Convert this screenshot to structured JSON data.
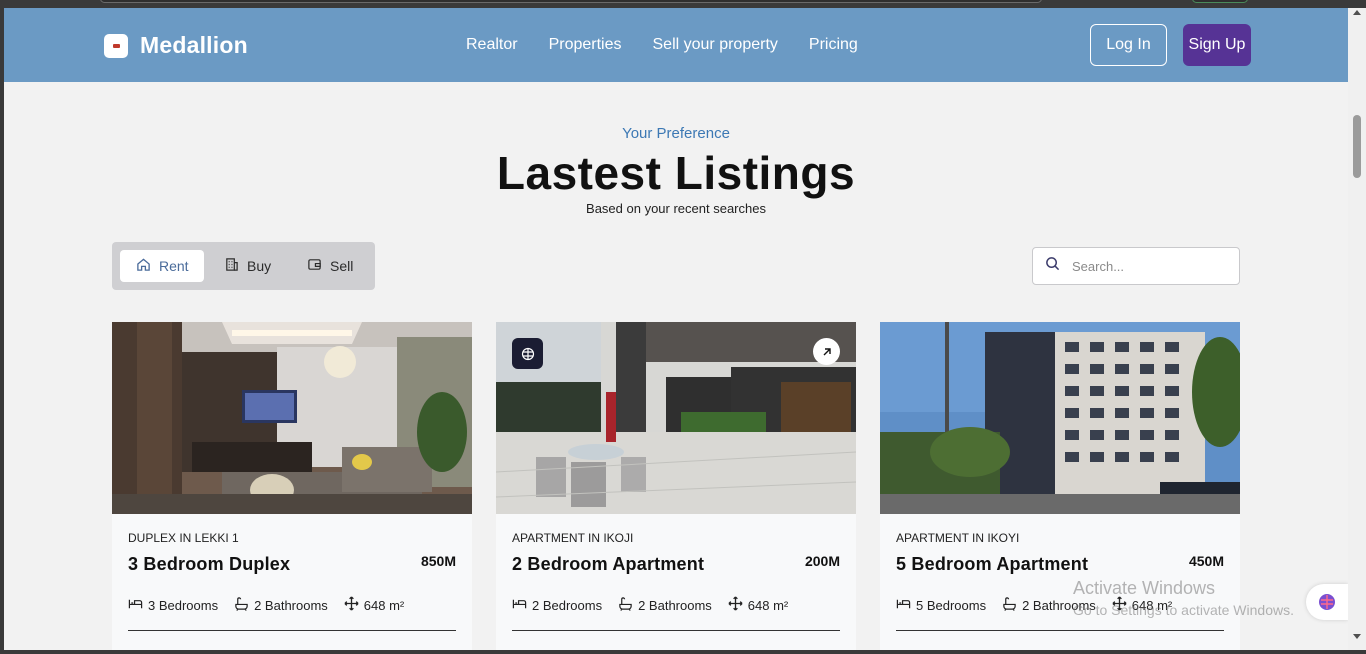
{
  "brand": {
    "name": "Medallion"
  },
  "nav": {
    "links": [
      "Realtor",
      "Properties",
      "Sell your property",
      "Pricing"
    ],
    "login": "Log In",
    "signup": "Sign Up"
  },
  "section": {
    "kicker": "Your Preference",
    "title": "Lastest Listings",
    "subtitle": "Based on your recent searches"
  },
  "tabs": [
    {
      "label": "Rent",
      "icon": "home-icon",
      "active": true
    },
    {
      "label": "Buy",
      "icon": "building-icon",
      "active": false
    },
    {
      "label": "Sell",
      "icon": "wallet-icon",
      "active": false
    }
  ],
  "search": {
    "placeholder": "Search..."
  },
  "listings": [
    {
      "type": "DUPLEX IN LEKKI 1",
      "title": "3 Bedroom Duplex",
      "price": "850M",
      "bedrooms": "3 Bedrooms",
      "bathrooms": "2 Bathrooms",
      "area": "648 m²",
      "image": "living-room-photo"
    },
    {
      "type": "APARTMENT IN IKOJI",
      "title": "2 Bedroom Apartment",
      "price": "200M",
      "bedrooms": "2 Bedrooms",
      "bathrooms": "2 Bathrooms",
      "area": "648 m²",
      "image": "patio-building-photo"
    },
    {
      "type": "APARTMENT IN IKOYI",
      "title": "5 Bedroom Apartment",
      "price": "450M",
      "bedrooms": "5 Bedrooms",
      "bathrooms": "2 Bathrooms",
      "area": "648 m²",
      "image": "tower-building-photo"
    }
  ],
  "watermark": {
    "line1": "Activate Windows",
    "line2": "Go to Settings to activate Windows."
  },
  "colors": {
    "navbar": "#6b9ac4",
    "signup": "#563395",
    "kicker": "#3c78b4",
    "page": "#f2f2f2"
  }
}
